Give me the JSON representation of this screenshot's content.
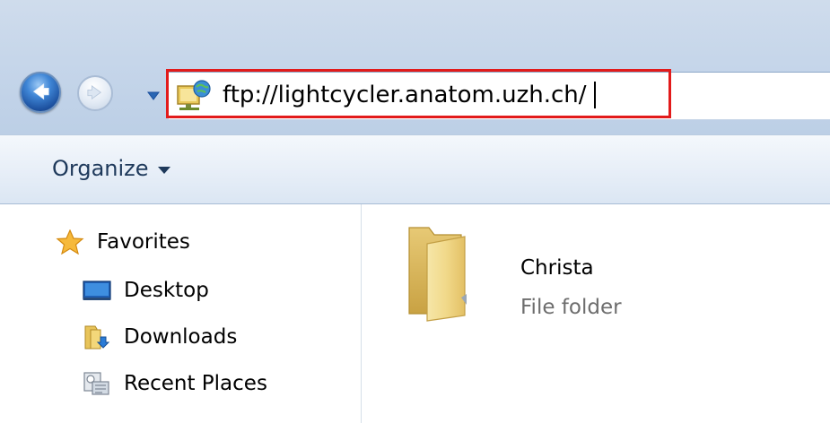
{
  "address_bar": {
    "value": "ftp://lightcycler.anatom.uzh.ch/",
    "location_icon": "ftp-site-icon",
    "highlight_color": "#e21b1b"
  },
  "navigation": {
    "back_icon": "back-arrow-icon",
    "forward_icon": "forward-arrow-icon",
    "history_icon": "chevron-down-icon"
  },
  "toolbar": {
    "organize_label": "Organize"
  },
  "sidebar": {
    "items": [
      {
        "label": "Favorites",
        "icon": "star-icon"
      },
      {
        "label": "Desktop",
        "icon": "desktop-icon"
      },
      {
        "label": "Downloads",
        "icon": "downloads-icon"
      },
      {
        "label": "Recent Places",
        "icon": "recent-places-icon"
      }
    ]
  },
  "content": {
    "items": [
      {
        "name": "Christa",
        "type": "File folder",
        "icon": "folder-icon"
      }
    ]
  },
  "colors": {
    "accent": "#1e395b",
    "titlebar": "#c6d6ea"
  }
}
